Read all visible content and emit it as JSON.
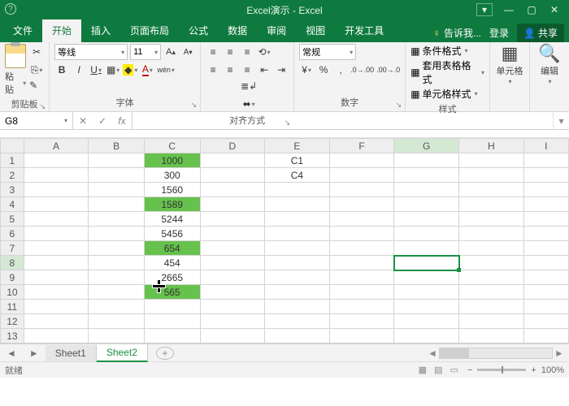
{
  "titlebar": {
    "title": "Excel演示 - Excel"
  },
  "window_controls": {
    "tray": "▾",
    "min": "—",
    "max": "▢",
    "close": "✕"
  },
  "tabs": {
    "file": "文件",
    "items": [
      "开始",
      "插入",
      "页面布局",
      "公式",
      "数据",
      "审阅",
      "视图",
      "开发工具"
    ],
    "active": 0,
    "tell_me": "告诉我...",
    "login": "登录",
    "share": "共享"
  },
  "ribbon": {
    "clipboard": {
      "paste": "粘贴",
      "label": "剪贴板"
    },
    "font": {
      "name": "等线",
      "size": "11",
      "bold": "B",
      "italic": "I",
      "underline": "U",
      "label": "字体"
    },
    "align": {
      "label": "对齐方式",
      "wrap_icon": "≡",
      "merge_icon": "⬌"
    },
    "number": {
      "format": "常规",
      "label": "数字"
    },
    "styles": {
      "cond": "条件格式",
      "table": "套用表格格式",
      "cell": "单元格样式",
      "label": "样式"
    },
    "cells": {
      "label": "单元格"
    },
    "editing": {
      "label": "编辑"
    }
  },
  "namebox": {
    "ref": "G8"
  },
  "formula": {
    "value": ""
  },
  "columns": [
    "A",
    "B",
    "C",
    "D",
    "E",
    "F",
    "G",
    "H",
    "I"
  ],
  "rows": [
    {
      "n": 1,
      "C": "1000",
      "C_hl": true,
      "E": "C1"
    },
    {
      "n": 2,
      "C": "300",
      "C_hl": false,
      "E": "C4"
    },
    {
      "n": 3,
      "C": "1560",
      "C_hl": false
    },
    {
      "n": 4,
      "C": "1589",
      "C_hl": true
    },
    {
      "n": 5,
      "C": "5244",
      "C_hl": false
    },
    {
      "n": 6,
      "C": "5456",
      "C_hl": false
    },
    {
      "n": 7,
      "C": "654",
      "C_hl": true
    },
    {
      "n": 8,
      "C": "454",
      "C_hl": false
    },
    {
      "n": 9,
      "C": "2665",
      "C_hl": false
    },
    {
      "n": 10,
      "C": "565",
      "C_hl": true
    },
    {
      "n": 11
    },
    {
      "n": 12
    },
    {
      "n": 13
    }
  ],
  "active_cell": {
    "col": "G",
    "row": 8
  },
  "sheets": {
    "items": [
      "Sheet1",
      "Sheet2"
    ],
    "active": 1
  },
  "status": {
    "ready": "就绪",
    "zoom": "100%"
  }
}
